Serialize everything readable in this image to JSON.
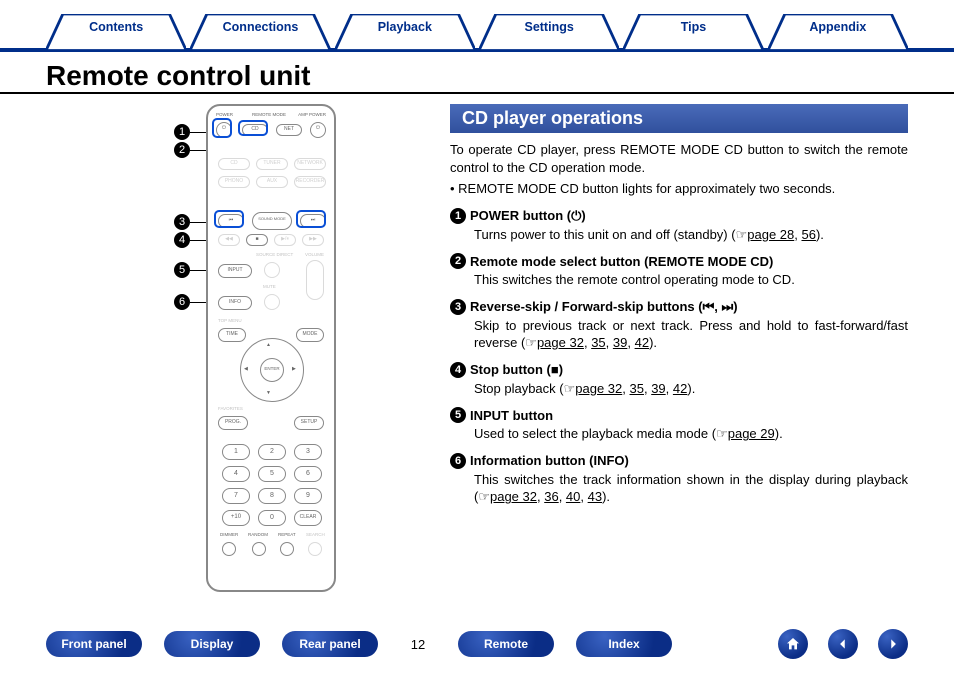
{
  "tabs": [
    "Contents",
    "Connections",
    "Playback",
    "Settings",
    "Tips",
    "Appendix"
  ],
  "page_title": "Remote control unit",
  "section_title": "CD player operations",
  "intro": "To operate CD player, press REMOTE MODE CD button to switch the remote control to the CD operation mode.",
  "note": "• REMOTE MODE CD button lights for approximately two seconds.",
  "defs": [
    {
      "n": "1",
      "head": "POWER button (⏻)",
      "body_pre": "Turns power to this unit on and off (standby) (☞",
      "pages": [
        "page 28",
        "56"
      ],
      "body_post": ")."
    },
    {
      "n": "2",
      "head": "Remote mode select button (REMOTE MODE CD)",
      "body_pre": "This switches the remote control operating mode to CD.",
      "pages": [],
      "body_post": ""
    },
    {
      "n": "3",
      "head": "Reverse-skip / Forward-skip buttons (⏮, ⏭)",
      "body_pre": "Skip to previous track or next track. Press and hold to fast-forward/fast reverse (☞",
      "pages": [
        "page 32",
        "35",
        "39",
        "42"
      ],
      "body_post": ")."
    },
    {
      "n": "4",
      "head": "Stop button (■)",
      "body_pre": "Stop playback (☞",
      "pages": [
        "page 32",
        "35",
        "39",
        "42"
      ],
      "body_post": ")."
    },
    {
      "n": "5",
      "head": "INPUT button",
      "body_pre": "Used to select the playback media mode (☞",
      "pages": [
        "page 29"
      ],
      "body_post": ")."
    },
    {
      "n": "6",
      "head": "Information button (INFO)",
      "body_pre": "This switches the track information shown in the display during playback (☞",
      "pages": [
        "page 32",
        "36",
        "40",
        "43"
      ],
      "body_post": ")."
    }
  ],
  "callouts": [
    "1",
    "2",
    "3",
    "4",
    "5",
    "6"
  ],
  "remote_labels": {
    "power": "POWER",
    "remote_mode": "REMOTE MODE",
    "amp_power": "AMP POWER",
    "cd_oval": "CD",
    "net": "NET",
    "row1": [
      "CD",
      "TUNER",
      "NETWORK"
    ],
    "row2": [
      "PHONO",
      "AUX",
      "RECORDER"
    ],
    "skip_prev": "⏮",
    "sound_mode": "SOUND MODE",
    "skip_next": "⏭",
    "rewind": "◀◀",
    "stop": "■",
    "playpause": "▶/⏸",
    "ffwd": "▶▶",
    "source_direct": "SOURCE DIRECT",
    "input": "INPUT",
    "mute": "MUTE",
    "volume": "VOLUME",
    "info": "INFO",
    "top_menu": "TOP MENU",
    "time": "TIME",
    "mode": "MODE",
    "enter": "ENTER",
    "favorites": "FAVORITES",
    "program": "PROG.",
    "setup": "SETUP",
    "numpad": [
      "1",
      "2",
      "3",
      "4",
      "5",
      "6",
      "7",
      "8",
      "9",
      "+10",
      "0",
      "CLEAR"
    ],
    "bottom": [
      "DIMMER",
      "RANDOM",
      "REPEAT",
      "SEARCH"
    ]
  },
  "bottom_nav": {
    "left": [
      "Front panel",
      "Display",
      "Rear panel"
    ],
    "page": "12",
    "right": [
      "Remote",
      "Index"
    ]
  }
}
